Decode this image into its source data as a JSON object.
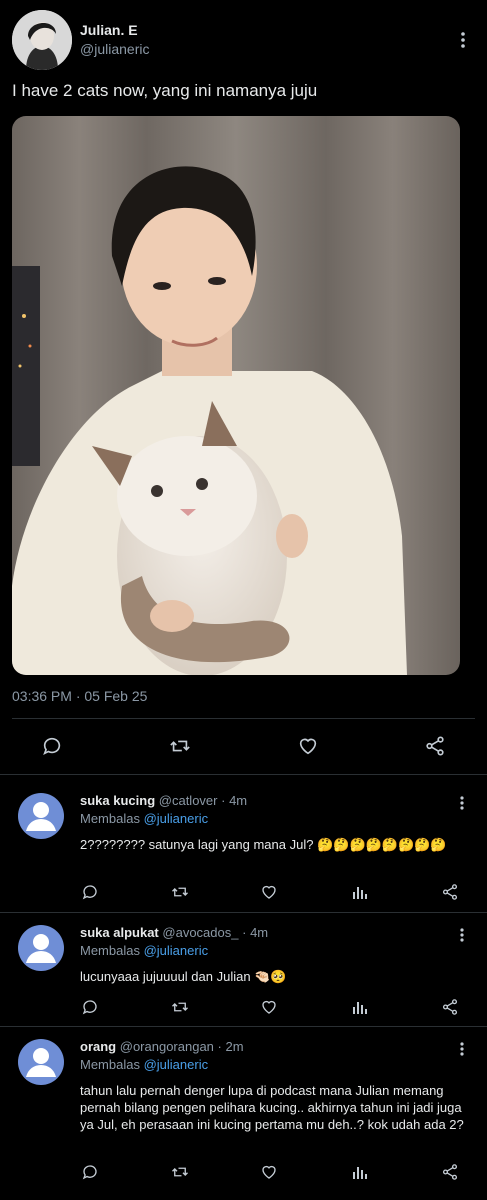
{
  "post": {
    "author_name": "Julian. E",
    "author_handle": "@julianeric",
    "text": "I have 2 cats now, yang ini namanya juju",
    "timestamp": "03:36 PM · 05 Feb 25"
  },
  "replies": [
    {
      "name": "suka kucing",
      "handle": "@catlover",
      "time": "4m",
      "replying_prefix": "Membalas",
      "replying_to": "@julianeric",
      "text": "2???????? satunya lagi yang mana Jul? 🤔🤔🤔🤔🤔🤔🤔🤔"
    },
    {
      "name": "suka alpukat",
      "handle": "@avocados_",
      "time": "4m",
      "replying_prefix": "Membalas",
      "replying_to": "@julianeric",
      "text": "lucunyaaa jujuuuul dan Julian 🤏🏻🥺"
    },
    {
      "name": "orang",
      "handle": "@orangorangan",
      "time": "2m",
      "replying_prefix": "Membalas",
      "replying_to": "@julianeric",
      "text": "tahun lalu pernah denger lupa di podcast mana Julian memang pernah bilang pengen pelihara kucing.. akhirnya tahun ini jadi juga ya Jul, eh perasaan ini kucing pertama mu deh..? kok udah ada 2?"
    }
  ],
  "colors": {
    "background": "#000000",
    "text_primary": "#e7e9ea",
    "text_secondary": "#8b98a5",
    "link": "#4a9fe8",
    "icon": "#c4ccd4",
    "avatar_placeholder": "#6f8ed6"
  },
  "icons": {
    "post_actions": [
      "reply-icon",
      "retweet-icon",
      "like-icon",
      "share-icon"
    ],
    "reply_actions": [
      "reply-icon",
      "retweet-icon",
      "like-icon",
      "analytics-icon",
      "share-icon"
    ]
  }
}
